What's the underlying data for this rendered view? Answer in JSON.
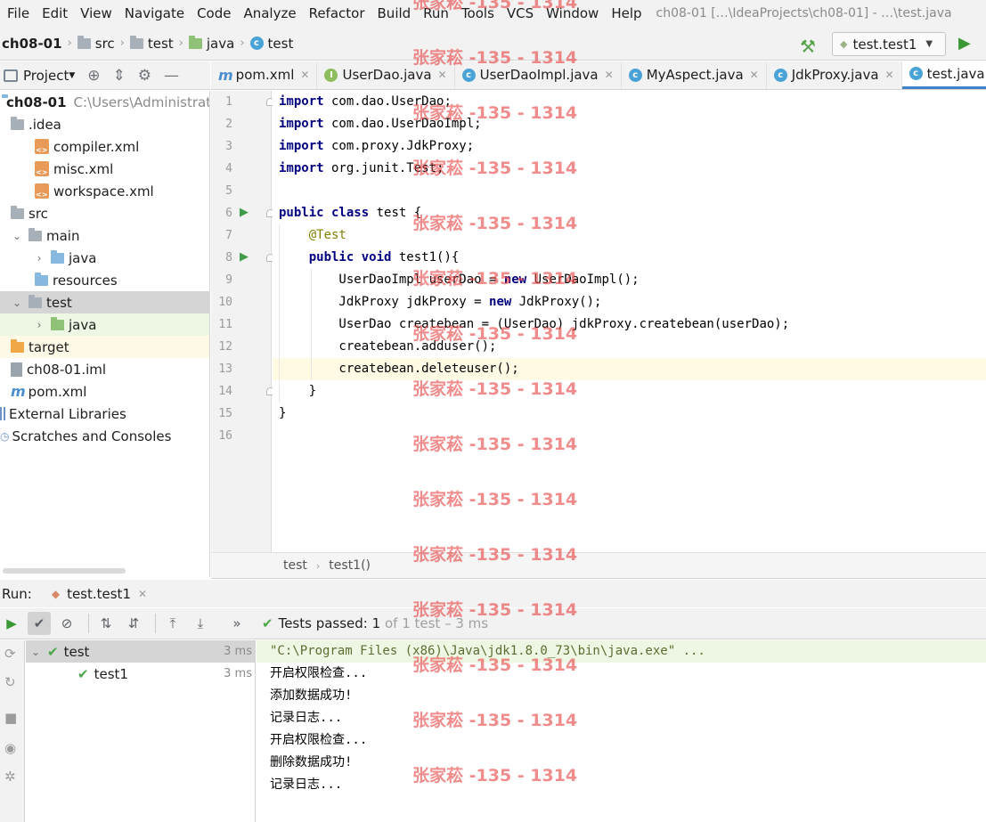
{
  "menu": {
    "items": [
      "File",
      "Edit",
      "View",
      "Navigate",
      "Code",
      "Analyze",
      "Refactor",
      "Build",
      "Run",
      "Tools",
      "VCS",
      "Window",
      "Help"
    ],
    "window_title": "ch08-01 […\\IdeaProjects\\ch08-01] - …\\test.java"
  },
  "breadcrumb": {
    "items": [
      "ch08-01",
      "src",
      "test",
      "java",
      "test"
    ],
    "icons": [
      "none",
      "folder-icon",
      "folder-icon",
      "source-folder-icon",
      "class-icon"
    ]
  },
  "run_config": {
    "label": "test.test1"
  },
  "project_panel": {
    "title": "Project",
    "tree": [
      {
        "label": "ch08-01",
        "hint": "C:\\Users\\Administrato",
        "icon": "module-folder-icon",
        "indent": 0,
        "bold": true
      },
      {
        "label": ".idea",
        "icon": "folder-icon",
        "indent": 1
      },
      {
        "label": "compiler.xml",
        "icon": "xml-file-icon",
        "indent": 2
      },
      {
        "label": "misc.xml",
        "icon": "xml-file-icon",
        "indent": 2
      },
      {
        "label": "workspace.xml",
        "icon": "xml-file-icon",
        "indent": 2
      },
      {
        "label": "src",
        "icon": "folder-icon",
        "indent": 1
      },
      {
        "label": "main",
        "icon": "folder-icon",
        "indent": 1,
        "arrow": "expanded"
      },
      {
        "label": "java",
        "icon": "source-folder-icon",
        "indent": 2,
        "arrow": "collapsed"
      },
      {
        "label": "resources",
        "icon": "resources-folder-icon",
        "indent": 2
      },
      {
        "label": "test",
        "icon": "folder-icon",
        "indent": 1,
        "arrow": "expanded",
        "state": "selected"
      },
      {
        "label": "java",
        "icon": "test-folder-icon",
        "indent": 2,
        "arrow": "collapsed",
        "state": "test-root"
      },
      {
        "label": "target",
        "icon": "excluded-folder-icon",
        "indent": 1,
        "state": "excluded"
      },
      {
        "label": "ch08-01.iml",
        "icon": "iml-file-icon",
        "indent": 1
      },
      {
        "label": "pom.xml",
        "icon": "maven-icon",
        "indent": 1
      },
      {
        "label": "External Libraries",
        "icon": "libraries-icon",
        "indent": 0
      },
      {
        "label": "Scratches and Consoles",
        "icon": "scratches-icon",
        "indent": 0
      }
    ]
  },
  "editor_tabs": [
    {
      "label": "pom.xml",
      "icon": "maven-icon"
    },
    {
      "label": "UserDao.java",
      "icon": "interface-icon"
    },
    {
      "label": "UserDaoImpl.java",
      "icon": "class-icon"
    },
    {
      "label": "MyAspect.java",
      "icon": "class-icon"
    },
    {
      "label": "JdkProxy.java",
      "icon": "class-icon"
    },
    {
      "label": "test.java",
      "icon": "test-class-icon",
      "active": true
    }
  ],
  "editor": {
    "lines": [
      [
        {
          "t": "import",
          "c": "kw"
        },
        {
          "t": " com.dao.UserDao;"
        }
      ],
      [
        {
          "t": "import",
          "c": "kw"
        },
        {
          "t": " com.dao.UserDaoImpl;"
        }
      ],
      [
        {
          "t": "import",
          "c": "kw"
        },
        {
          "t": " com.proxy.JdkProxy;"
        }
      ],
      [
        {
          "t": "import",
          "c": "kw"
        },
        {
          "t": " org.junit.Test;"
        }
      ],
      [],
      [
        {
          "t": "public class",
          "c": "kw"
        },
        {
          "t": " test {"
        }
      ],
      [
        {
          "t": "    "
        },
        {
          "t": "@Test",
          "c": "ann"
        }
      ],
      [
        {
          "t": "    "
        },
        {
          "t": "public void",
          "c": "kw"
        },
        {
          "t": " test1(){"
        }
      ],
      [
        {
          "t": "        UserDaoImpl userDao = "
        },
        {
          "t": "new",
          "c": "kw"
        },
        {
          "t": " UserDaoImpl();"
        }
      ],
      [
        {
          "t": "        JdkProxy jdkProxy = "
        },
        {
          "t": "new",
          "c": "kw"
        },
        {
          "t": " JdkProxy();"
        }
      ],
      [
        {
          "t": "        UserDao createbean = (UserDao) jdkProxy.createbean(userDao);"
        }
      ],
      [
        {
          "t": "        createbean.adduser();"
        }
      ],
      [
        {
          "t": "        createbean.deleteuser();"
        }
      ],
      [
        {
          "t": "    }"
        }
      ],
      [
        {
          "t": "}"
        }
      ],
      []
    ],
    "current_line": 13,
    "run_markers": [
      6,
      8
    ],
    "breadcrumb": [
      "test",
      "test1()"
    ]
  },
  "run_panel": {
    "label": "Run:",
    "tab": "test.test1",
    "status_prefix": "Tests passed:",
    "status_count": "1",
    "status_suffix": "of 1 test – 3 ms",
    "tree": [
      {
        "label": "test",
        "time": "3 ms",
        "indent": 0
      },
      {
        "label": "test1",
        "time": "3 ms",
        "indent": 1
      }
    ],
    "console": [
      "\"C:\\Program Files (x86)\\Java\\jdk1.8.0_73\\bin\\java.exe\" ...",
      "开启权限检查...",
      "添加数据成功!",
      "记录日志...",
      "开启权限检查...",
      "删除数据成功!",
      "记录日志..."
    ]
  },
  "watermark": {
    "text": "张家菘 -135 - 1314"
  },
  "colors": {
    "accent": "#4083c9",
    "pass_green": "#4aa84a",
    "keyword": "#000080",
    "annotation": "#808000",
    "watermark": "#e84646"
  }
}
